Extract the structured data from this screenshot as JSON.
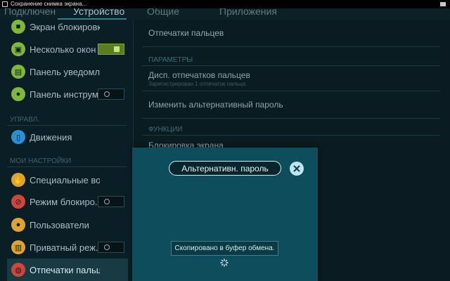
{
  "status_bar": {
    "notification": "Сохранение снимка экрана..."
  },
  "tabs": [
    {
      "label": "Подключен"
    },
    {
      "label": "Устройство"
    },
    {
      "label": "Общие"
    },
    {
      "label": "Приложения"
    }
  ],
  "sidebar": {
    "items": [
      {
        "label": "Экран блокировки",
        "icon": "lock-screen-icon",
        "color": "#7fb83a"
      },
      {
        "label": "Несколько окон",
        "icon": "multi-window-icon",
        "color": "#7fb83a",
        "toggle": "on"
      },
      {
        "label": "Панель уведомлений",
        "icon": "notification-panel-icon",
        "color": "#7fb83a"
      },
      {
        "label": "Панель инструм...",
        "icon": "toolbox-icon",
        "color": "#7fb83a",
        "toggle": "off"
      },
      {
        "label": "Движения",
        "icon": "motion-icon",
        "color": "#2a8fd4"
      },
      {
        "label": "Специальные возможно...",
        "icon": "accessibility-icon",
        "color": "#e0a32b"
      },
      {
        "label": "Режим блокиро...",
        "icon": "blocking-mode-icon",
        "color": "#d0453b",
        "toggle": "off"
      },
      {
        "label": "Пользователи",
        "icon": "users-icon",
        "color": "#e0a32b"
      },
      {
        "label": "Приватный реж...",
        "icon": "private-mode-icon",
        "color": "#e0a32b",
        "toggle": "off"
      },
      {
        "label": "Отпечатки пальцев",
        "icon": "fingerprint-icon",
        "color": "#d0453b",
        "selected": true
      }
    ],
    "sections": {
      "control": "УПРАВЛ.",
      "my_settings": "МОИ НАСТРОЙКИ"
    }
  },
  "content": {
    "title": "Отпечатки пальцев",
    "section_params": "ПАРАМЕТРЫ",
    "fingerprint_manager": "Дисп. отпечатков пальцев",
    "registered_note": "Зарегистрирован 1 отпечаток пальца.",
    "change_password": "Изменить альтернативный пароль",
    "section_functions": "ФУНКЦИИ",
    "screen_lock": "Блокировка экрана"
  },
  "dialog": {
    "password_label": "Альтернативн. пароль",
    "toast": "Скопировано в буфер обмена."
  }
}
